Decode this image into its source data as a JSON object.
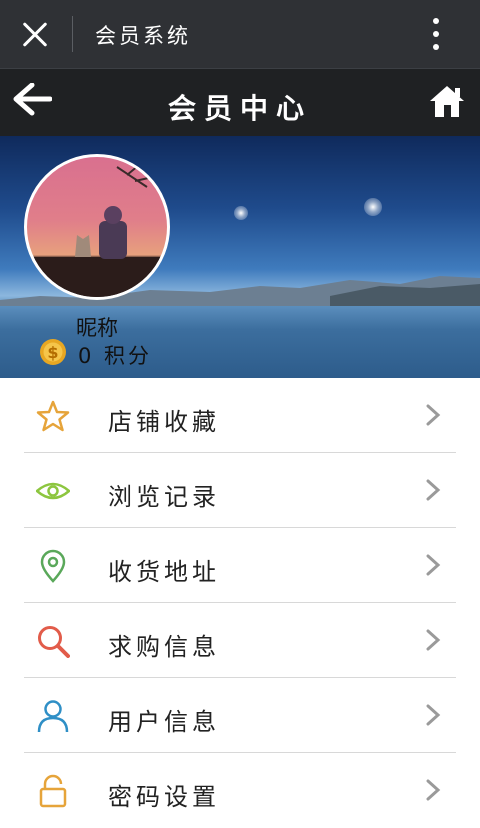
{
  "window": {
    "title": "会员系统"
  },
  "header": {
    "title": "会员中心"
  },
  "profile": {
    "nickname": "昵称",
    "points_text": "0 积分"
  },
  "menu": {
    "items": [
      {
        "label": "店铺收藏",
        "icon": "star-icon",
        "color": "#e6a43a"
      },
      {
        "label": "浏览记录",
        "icon": "eye-icon",
        "color": "#8dc63f"
      },
      {
        "label": "收货地址",
        "icon": "location-pin-icon",
        "color": "#5aa85a"
      },
      {
        "label": "求购信息",
        "icon": "search-icon",
        "color": "#e25c4a"
      },
      {
        "label": "用户信息",
        "icon": "user-icon",
        "color": "#2f8fc6"
      },
      {
        "label": "密码设置",
        "icon": "lock-icon",
        "color": "#e6a43a"
      }
    ]
  }
}
